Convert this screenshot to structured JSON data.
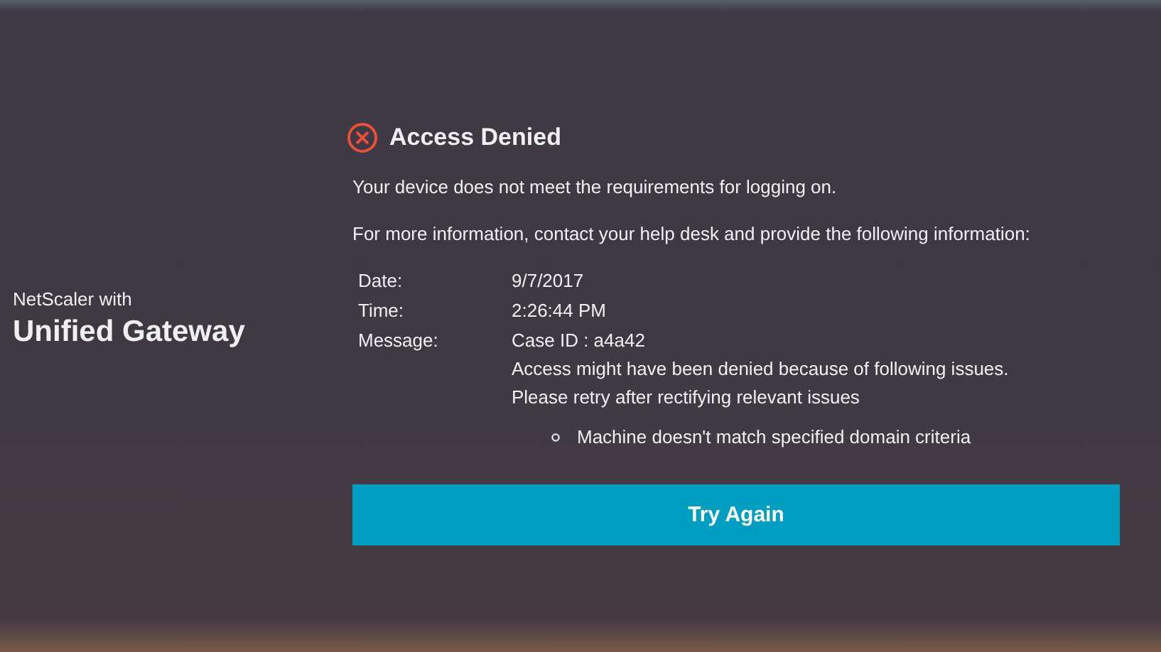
{
  "brand": {
    "subtitle": "NetScaler with",
    "title": "Unified Gateway"
  },
  "dialog": {
    "kind": "error",
    "title": "Access Denied",
    "message": "Your device does not meet the requirements for logging on.",
    "info_prompt": "For more information, contact your help desk and provide the following information:",
    "details": [
      {
        "label": "Date:",
        "value": "9/7/2017"
      },
      {
        "label": "Time:",
        "value": "2:26:44 PM"
      },
      {
        "label": "Message:",
        "value": "Case ID : a4a42"
      }
    ],
    "explanation": "Access might have been denied because of following issues. Please retry after rectifying relevant issues",
    "issues": [
      "Machine doesn't match specified domain criteria"
    ],
    "button": "Try Again"
  }
}
